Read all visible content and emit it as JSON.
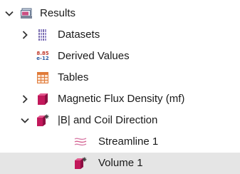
{
  "tree": {
    "results": {
      "label": "Results",
      "expanded": true,
      "icon": "results-folder-icon"
    },
    "datasets": {
      "label": "Datasets",
      "expanded": false,
      "icon": "datasets-icon"
    },
    "derived_values": {
      "label": "Derived Values",
      "icon": "derived-values-icon",
      "icon_text_top": "8.85",
      "icon_text_bottom": "e-12"
    },
    "tables": {
      "label": "Tables",
      "icon": "table-icon"
    },
    "magnetic_flux": {
      "label": "Magnetic Flux Density (mf)",
      "expanded": false,
      "icon": "plot-group-3d-icon"
    },
    "coil_direction": {
      "label": "|B| and Coil Direction",
      "expanded": true,
      "icon": "plot-group-3d-star-icon"
    },
    "streamline": {
      "label": "Streamline 1",
      "icon": "streamline-icon"
    },
    "volume": {
      "label": "Volume 1",
      "icon": "volume-plot-icon",
      "selected": true
    }
  },
  "colors": {
    "selection_background": "#e5e5e5",
    "plot_magenta": "#c2185b",
    "table_orange": "#e07b39",
    "dataset_purple": "#7b6fb0"
  }
}
